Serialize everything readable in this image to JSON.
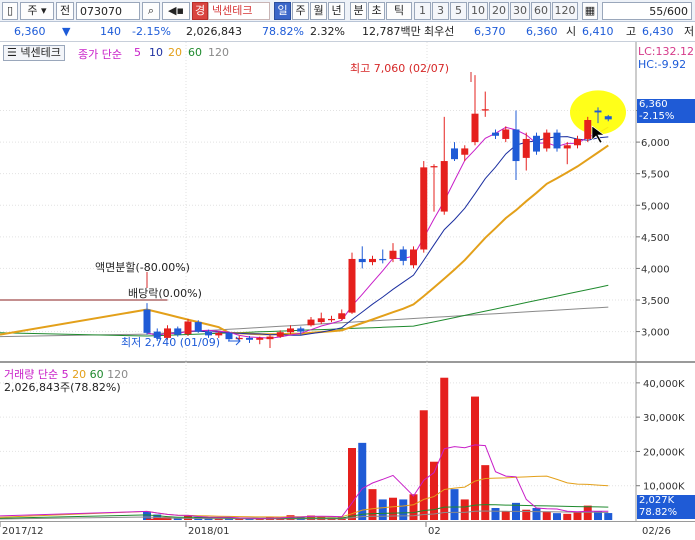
{
  "toolbar": {
    "market_label": "주",
    "type_label": "전",
    "code": "073070",
    "search_icon": "search-icon",
    "prev_icon": "speaker-icon",
    "badge_label": "경",
    "stock_name": "넥센테크",
    "period_tabs": [
      "일",
      "주",
      "월",
      "년",
      "분",
      "초",
      "틱"
    ],
    "active_period": "일",
    "intervals": [
      "1",
      "3",
      "5",
      "10",
      "20",
      "30",
      "60",
      "120"
    ],
    "count_value": "55/600"
  },
  "quote": {
    "price": "6,360",
    "direction": "▼",
    "change": "140",
    "change_pct": "-2.15%",
    "volume": "2,026,843",
    "vol_ratio": "78.82%",
    "turnover_pct": "2.32%",
    "amount": "12,787백만",
    "best_label": "최우선",
    "ask": "6,370",
    "bid": "6,360",
    "open_label": "시",
    "open": "6,410",
    "high_label": "고",
    "high": "6,430",
    "low_label": "저"
  },
  "chart_header": {
    "name": "넥센테크",
    "ma_label": "종가 단순",
    "ma_periods": [
      "5",
      "10",
      "20",
      "60",
      "120"
    ],
    "lc": "LC:132.12",
    "hc": "HC:-9.92"
  },
  "colors": {
    "up": "#e5201d",
    "down": "#1f5bd6",
    "ma5": "#c81ec8",
    "ma10": "#1c2fa0",
    "ma20": "#e3a01a",
    "ma60": "#1f8a2e",
    "ma120": "#8a8a8a"
  },
  "annotations": {
    "high": "최고 7,060 (02/07)",
    "low": "최저 2,740 (01/09)",
    "split": "액면분할(-80.00%)",
    "exdiv": "배당락(0.00%)",
    "price_tag": "6,360",
    "price_tag_pct": "-2.15%"
  },
  "volume_header": {
    "label": "거래량",
    "ma_label": "단순",
    "ma_periods": [
      "5",
      "20",
      "60",
      "120"
    ],
    "current": "2,026,843주(78.82%)",
    "tag_value": "2,027K",
    "tag_pct": "78.82%"
  },
  "x_axis": {
    "labels": [
      "2017/12",
      "2018/01",
      "02",
      "02/26"
    ]
  },
  "chart_data": {
    "type": "candlestick",
    "price_axis": {
      "ticks": [
        3000,
        3500,
        4000,
        4500,
        5000,
        5500,
        6000,
        6500
      ],
      "min": 2550,
      "max": 7300
    },
    "volume_axis": {
      "ticks": [
        10000,
        20000,
        30000,
        40000
      ],
      "labels": [
        "10,000K",
        "20,000K",
        "30,000K",
        "40,000K"
      ],
      "max": 42000
    },
    "candles": [
      {
        "o": 3350,
        "c": 2980,
        "h": 3450,
        "l": 2950,
        "v": 2500
      },
      {
        "o": 3000,
        "c": 2900,
        "h": 3050,
        "l": 2850,
        "v": 1600
      },
      {
        "o": 2900,
        "c": 3050,
        "h": 3100,
        "l": 2870,
        "v": 800
      },
      {
        "o": 3050,
        "c": 2950,
        "h": 3080,
        "l": 2920,
        "v": 600
      },
      {
        "o": 2960,
        "c": 3160,
        "h": 3200,
        "l": 2930,
        "v": 1200
      },
      {
        "o": 3150,
        "c": 3000,
        "h": 3180,
        "l": 2980,
        "v": 900
      },
      {
        "o": 3000,
        "c": 2940,
        "h": 3030,
        "l": 2900,
        "v": 700
      },
      {
        "o": 2940,
        "c": 2980,
        "h": 3000,
        "l": 2900,
        "v": 500
      },
      {
        "o": 2980,
        "c": 2880,
        "h": 3000,
        "l": 2850,
        "v": 600
      },
      {
        "o": 2880,
        "c": 2900,
        "h": 2930,
        "l": 2840,
        "v": 400
      },
      {
        "o": 2900,
        "c": 2870,
        "h": 2930,
        "l": 2820,
        "v": 500
      },
      {
        "o": 2870,
        "c": 2900,
        "h": 2920,
        "l": 2800,
        "v": 400
      },
      {
        "o": 2880,
        "c": 2920,
        "h": 2950,
        "l": 2740,
        "v": 900
      },
      {
        "o": 2920,
        "c": 2990,
        "h": 3020,
        "l": 2900,
        "v": 800
      },
      {
        "o": 2990,
        "c": 3050,
        "h": 3100,
        "l": 2960,
        "v": 1400
      },
      {
        "o": 3050,
        "c": 3000,
        "h": 3080,
        "l": 2950,
        "v": 900
      },
      {
        "o": 3100,
        "c": 3190,
        "h": 3230,
        "l": 3080,
        "v": 1300
      },
      {
        "o": 3150,
        "c": 3210,
        "h": 3300,
        "l": 3120,
        "v": 1000
      },
      {
        "o": 3180,
        "c": 3200,
        "h": 3250,
        "l": 3150,
        "v": 700
      },
      {
        "o": 3200,
        "c": 3290,
        "h": 3350,
        "l": 3180,
        "v": 800
      },
      {
        "o": 3300,
        "c": 4150,
        "h": 4250,
        "l": 3280,
        "v": 21000
      },
      {
        "o": 4150,
        "c": 4100,
        "h": 4350,
        "l": 4000,
        "v": 22500
      },
      {
        "o": 4100,
        "c": 4150,
        "h": 4200,
        "l": 4050,
        "v": 9000
      },
      {
        "o": 4150,
        "c": 4130,
        "h": 4300,
        "l": 4080,
        "v": 6000
      },
      {
        "o": 4150,
        "c": 4280,
        "h": 4400,
        "l": 4100,
        "v": 6500
      },
      {
        "o": 4300,
        "c": 4120,
        "h": 4350,
        "l": 4050,
        "v": 6000
      },
      {
        "o": 4050,
        "c": 4300,
        "h": 4350,
        "l": 4000,
        "v": 7500
      },
      {
        "o": 4300,
        "c": 5600,
        "h": 5700,
        "l": 4250,
        "v": 32000
      },
      {
        "o": 5600,
        "c": 5620,
        "h": 5650,
        "l": 4900,
        "v": 17000
      },
      {
        "o": 4900,
        "c": 5700,
        "h": 6400,
        "l": 4850,
        "v": 41500
      },
      {
        "o": 5900,
        "c": 5730,
        "h": 6000,
        "l": 5700,
        "v": 9000
      },
      {
        "o": 5800,
        "c": 5900,
        "h": 5950,
        "l": 5700,
        "v": 6000
      },
      {
        "o": 6000,
        "c": 6450,
        "h": 7060,
        "l": 5950,
        "v": 36000
      },
      {
        "o": 6500,
        "c": 6520,
        "h": 6800,
        "l": 6400,
        "v": 16000
      },
      {
        "o": 6150,
        "c": 6100,
        "h": 6200,
        "l": 6050,
        "v": 3500
      },
      {
        "o": 6050,
        "c": 6200,
        "h": 6250,
        "l": 6000,
        "v": 2500
      },
      {
        "o": 6200,
        "c": 5700,
        "h": 6500,
        "l": 5400,
        "v": 5000
      },
      {
        "o": 5750,
        "c": 6050,
        "h": 6150,
        "l": 5550,
        "v": 3000
      },
      {
        "o": 6100,
        "c": 5850,
        "h": 6150,
        "l": 5800,
        "v": 3500
      },
      {
        "o": 5900,
        "c": 6150,
        "h": 6200,
        "l": 5850,
        "v": 2500
      },
      {
        "o": 6150,
        "c": 5900,
        "h": 6200,
        "l": 5850,
        "v": 2000
      },
      {
        "o": 5900,
        "c": 5950,
        "h": 6000,
        "l": 5650,
        "v": 1800
      },
      {
        "o": 5950,
        "c": 6050,
        "h": 6100,
        "l": 5900,
        "v": 2200
      },
      {
        "o": 6050,
        "c": 6350,
        "h": 6400,
        "l": 6000,
        "v": 4200
      },
      {
        "o": 6500,
        "c": 6470,
        "h": 6550,
        "l": 6300,
        "v": 2600
      },
      {
        "o": 6410,
        "c": 6360,
        "h": 6430,
        "l": 6330,
        "v": 2027
      }
    ]
  }
}
